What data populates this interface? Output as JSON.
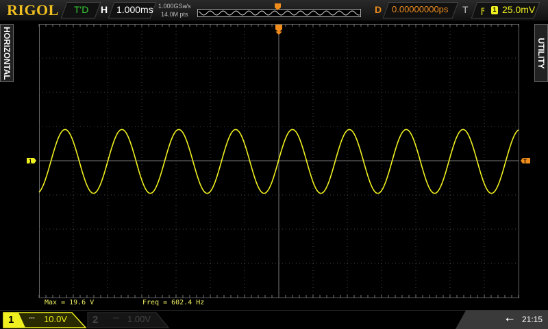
{
  "header": {
    "brand": "RIGOL",
    "run_status": "T'D",
    "horizontal_label": "H",
    "timebase": "1.000ms",
    "sample_rate": "1.000GSa/s",
    "memory_depth": "14.0M pts",
    "delay_label": "D",
    "delay_value": "0.00000000ps",
    "trigger_label": "T",
    "trigger_channel": "1",
    "trigger_level": "25.0mV"
  },
  "side_tabs": {
    "left": "HORIZONTAL",
    "right": "UTILITY"
  },
  "measurements": {
    "max": "Max = 19.6 V",
    "freq": "Freq = 602.4 Hz"
  },
  "channels": [
    {
      "num": "1",
      "coupling": "⎓",
      "scale": "10.0V",
      "active": true
    },
    {
      "num": "2",
      "coupling": "⎓",
      "scale": "1.00V",
      "active": false
    }
  ],
  "status": {
    "time": "21:15",
    "usb_icon": "usb-icon"
  },
  "colors": {
    "ch1": "#f0f020",
    "trigger": "#f08c1c",
    "grid": "#4a4a4a"
  },
  "waveform": {
    "frequency_hz": 602.4,
    "max_v": 19.6,
    "volts_per_div": 10.0,
    "time_per_div_ms": 1.0
  }
}
